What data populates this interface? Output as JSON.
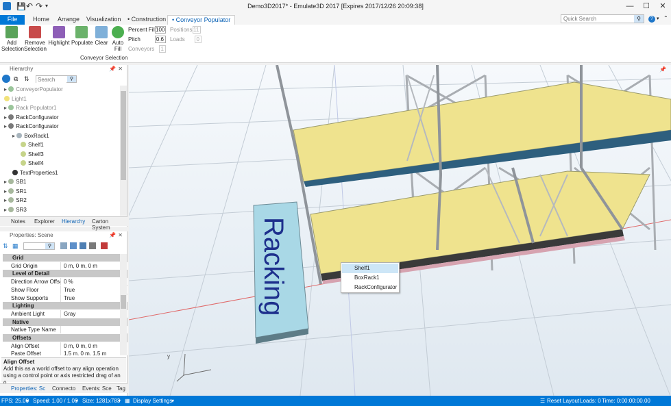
{
  "window": {
    "title": "Demo3D2017* - Emulate3D 2017 [Expires 2017/12/26 20:09:38]",
    "minimize": "—",
    "maximize": "☐",
    "close": "✕"
  },
  "tabs": {
    "file": "File",
    "home": "Home",
    "arrange": "Arrange",
    "visualization": "Visualization",
    "construction": "• Construction",
    "conveyor_populator": "• Conveyor Populator"
  },
  "quick_search": {
    "placeholder": "Quick Search"
  },
  "ribbon": {
    "add_selection": "Add Selection",
    "remove_selection": "Remove Selection",
    "highlight": "Highlight",
    "populate": "Populate",
    "clear": "Clear",
    "auto_fill": "Auto Fill",
    "percent_fill_label": "Percent Fill",
    "percent_fill_value": "100",
    "pitch_label": "Pitch",
    "pitch_value": "0.6",
    "conveyors_label": "Conveyors",
    "conveyors_value": "1",
    "positions_label": "Positions",
    "positions_value": "11",
    "loads_label": "Loads",
    "loads_value": "0",
    "group_label": "Conveyor Selection"
  },
  "hierarchy": {
    "title": "Hierarchy",
    "search_placeholder": "Search",
    "items": [
      {
        "label": "ConveyorPopulator",
        "dim": true
      },
      {
        "label": "Light1",
        "dim": true
      },
      {
        "label": "Rack Populator1",
        "dim": true
      },
      {
        "label": "RackConfigurator",
        "dim": false
      },
      {
        "label": "RackConfigurator",
        "dim": false
      },
      {
        "label": "BoxRack1",
        "dim": false
      },
      {
        "label": "Shelf1",
        "dim": false
      },
      {
        "label": "Shelf3",
        "dim": false
      },
      {
        "label": "Shelf4",
        "dim": false
      },
      {
        "label": "TextProperties1",
        "dim": false
      },
      {
        "label": "SB1",
        "dim": false
      },
      {
        "label": "SR1",
        "dim": false
      },
      {
        "label": "SR2",
        "dim": false
      },
      {
        "label": "SR3",
        "dim": false
      }
    ],
    "bottom_tabs": [
      "Notes",
      "Explorer",
      "Hierarchy",
      "Carton System"
    ]
  },
  "properties": {
    "title": "Properties: Scene",
    "rows": [
      {
        "type": "cat",
        "k": "Grid"
      },
      {
        "type": "row",
        "k": "Grid Origin",
        "v": "0 m, 0 m, 0 m"
      },
      {
        "type": "cat",
        "k": "Level of Detail"
      },
      {
        "type": "row",
        "k": "Direction Arrow Offse",
        "v": "0 %"
      },
      {
        "type": "row",
        "k": "Show Floor",
        "v": "True"
      },
      {
        "type": "row",
        "k": "Show Supports",
        "v": "True"
      },
      {
        "type": "cat",
        "k": "Lighting"
      },
      {
        "type": "row",
        "k": "Ambient Light",
        "v": "Gray"
      },
      {
        "type": "cat",
        "k": "Native"
      },
      {
        "type": "row",
        "k": "Native Type Name",
        "v": ""
      },
      {
        "type": "cat",
        "k": "Offsets"
      },
      {
        "type": "row",
        "k": "Align Offset",
        "v": "0 m, 0 m, 0 m"
      },
      {
        "type": "row",
        "k": "Paste Offset",
        "v": "1.5 m, 0 m, 1.5 m"
      }
    ],
    "desc_title": "Align Offset",
    "desc_text": "Add this as a world offset to any align operation using a control point or axis restricted drag of an o...",
    "bottom_tabs": [
      "Properties: Sc",
      "Connecto",
      "Events: Sce",
      "Tag"
    ]
  },
  "viewport": {
    "text_label": "Racking"
  },
  "context_menu": {
    "items": [
      "Shelf1",
      "BoxRack1",
      "RackConfigurator"
    ]
  },
  "status": {
    "fps": "FPS: 25.00",
    "speed": "Speed: 1.00 / 1.00",
    "size": "Size: 1281x783",
    "display_settings": "Display Settings",
    "reset_layout": "Reset Layout",
    "loads": "Loads: 0",
    "time": "Time: 0:00:00:00.00"
  },
  "colors": {
    "accent": "#0078d7",
    "shelf": "#efe38e",
    "grid": "#c9d3dc",
    "sign": "#a9d8e6"
  }
}
